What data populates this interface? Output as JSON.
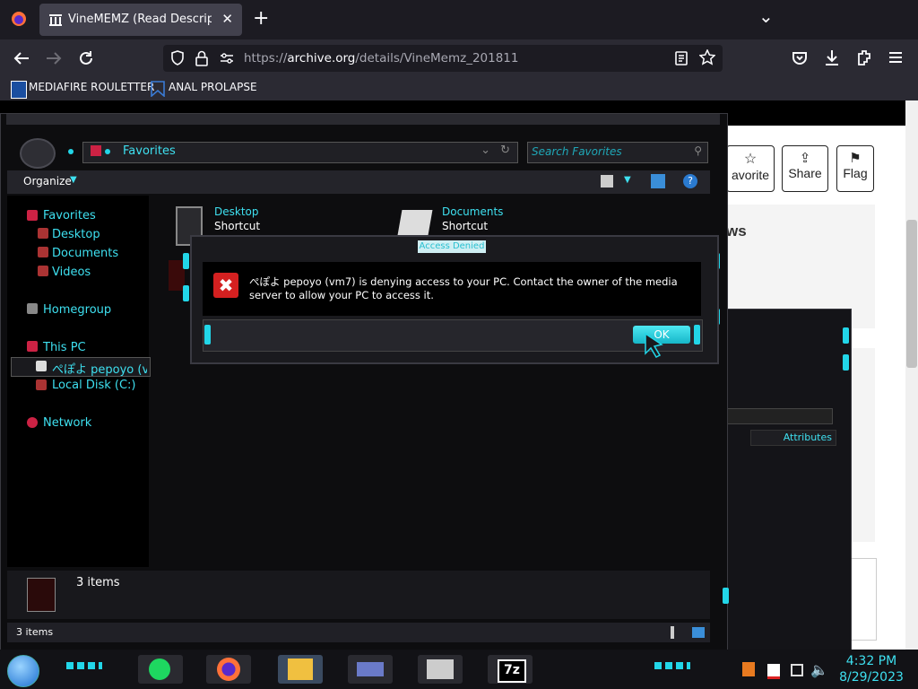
{
  "browser": {
    "tab_title": "VineMEMZ (Read Description) :",
    "tab_close": "✕",
    "new_tab": "+",
    "tab_list": "⌄",
    "url_prefix": "https://",
    "url_domain": "archive.org",
    "url_path": "/details/VineMemz_201811",
    "bookmarks": [
      {
        "label": "MEDIAFIRE ROULETTER"
      },
      {
        "label": "ANAL PROLAPSE"
      }
    ]
  },
  "webpage": {
    "buttons": [
      {
        "label": "avorite"
      },
      {
        "label": "Share"
      },
      {
        "label": "Flag"
      }
    ],
    "partial_heading": "ws",
    "partial_column": "Attributes"
  },
  "explorer": {
    "address": "Favorites",
    "search_placeholder": "Search Favorites",
    "organize": "Organize",
    "nav": {
      "favorites": "Favorites",
      "desktop": "Desktop",
      "documents": "Documents",
      "videos": "Videos",
      "homegroup": "Homegroup",
      "this_pc": "This PC",
      "media_server": "ぺぽよ pepoyo (vm",
      "local_disk": "Local Disk (C:)",
      "network": "Network"
    },
    "files": [
      {
        "name": "Desktop",
        "type": "Shortcut"
      },
      {
        "name": "Documents",
        "type": "Shortcut"
      }
    ],
    "details_count": "3 items",
    "status_count": "3 items"
  },
  "dialog": {
    "title": "Access Denied",
    "message": "ぺぽよ pepoyo (vm7) is denying access to your PC. Contact the owner of the media server to allow your PC to access it.",
    "ok_label": "OK"
  },
  "taskbar": {
    "time": "4:32 PM",
    "date": "8/29/2023",
    "sevenzip_label": "7z"
  },
  "colors": {
    "accent": "#22d6e8",
    "browser_bg": "#2b2a33",
    "error": "#d42020"
  }
}
